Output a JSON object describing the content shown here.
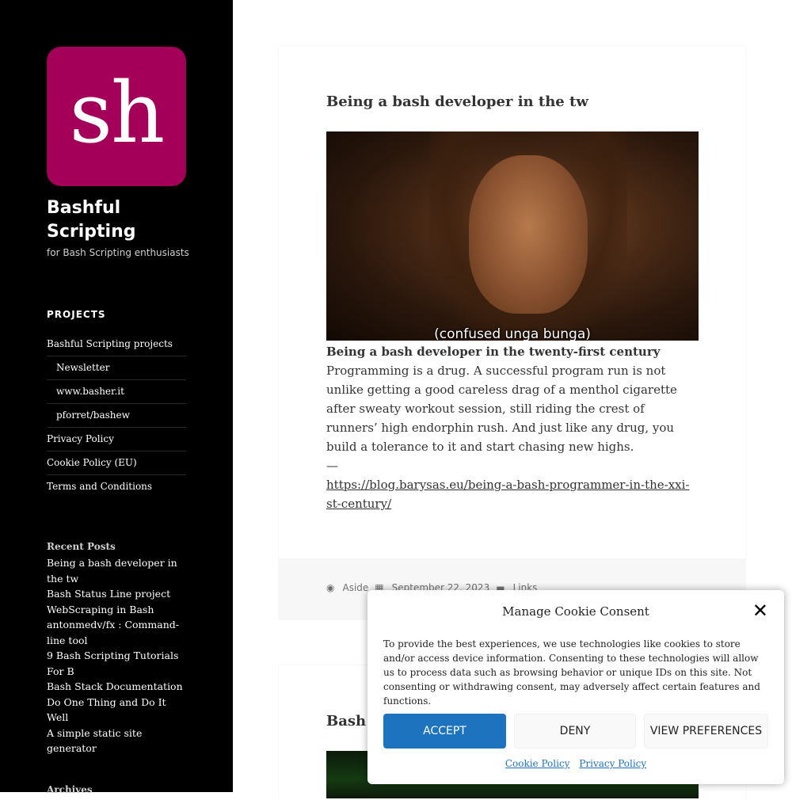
{
  "site": {
    "logo_text": "sh",
    "title": "Bashful Scripting",
    "description": "for Bash Scripting enthusiasts"
  },
  "projects": {
    "heading": "PROJECTS",
    "items": [
      {
        "label": "Bashful Scripting projects"
      },
      {
        "label": "Newsletter"
      },
      {
        "label": "www.basher.it"
      },
      {
        "label": "pforret/bashew"
      },
      {
        "label": "Privacy Policy"
      },
      {
        "label": "Cookie Policy (EU)"
      },
      {
        "label": "Terms and Conditions"
      }
    ]
  },
  "recent_posts": {
    "heading": "Recent Posts",
    "items": [
      "Being a bash developer in the tw",
      "Bash Status Line project",
      "WebScraping in Bash",
      "antonmedv/fx : Command-line tool",
      "9 Bash Scripting Tutorials For B",
      "Bash Stack Documentation",
      "Do One Thing and Do It Well",
      "A simple static site generator"
    ]
  },
  "archives_heading": "Archives",
  "post": {
    "title": "Being a bash developer in the tw",
    "image_caption": "(confused unga bunga)",
    "quote_title": "Being a bash developer in the twenty-first century",
    "quote_text": "Programming is a drug. A successful program run is not unlike getting a good careless drag of a menthol cigarette after sweaty workout session, still riding the crest of runners’ high endorphin rush. And just like any drug, you build a tolerance to it and start chasing new highs.",
    "dash": "—",
    "link": "https://blog.barysas.eu/being-a-bash-programmer-in-the-xxi-st-century/",
    "meta": {
      "format": "Aside",
      "date": "September 22, 2023",
      "category": "Links"
    }
  },
  "post2": {
    "title_partial": "Bash S"
  },
  "cookie": {
    "title": "Manage Cookie Consent",
    "close": "✕",
    "text": "To provide the best experiences, we use technologies like cookies to store and/or access device information. Consenting to these technologies will allow us to process data such as browsing behavior or unique IDs on this site. Not consenting or withdrawing consent, may adversely affect certain features and functions.",
    "accept": "ACCEPT",
    "deny": "DENY",
    "preferences": "VIEW PREFERENCES",
    "cookie_policy": "Cookie Policy",
    "privacy_policy": "Privacy Policy"
  }
}
